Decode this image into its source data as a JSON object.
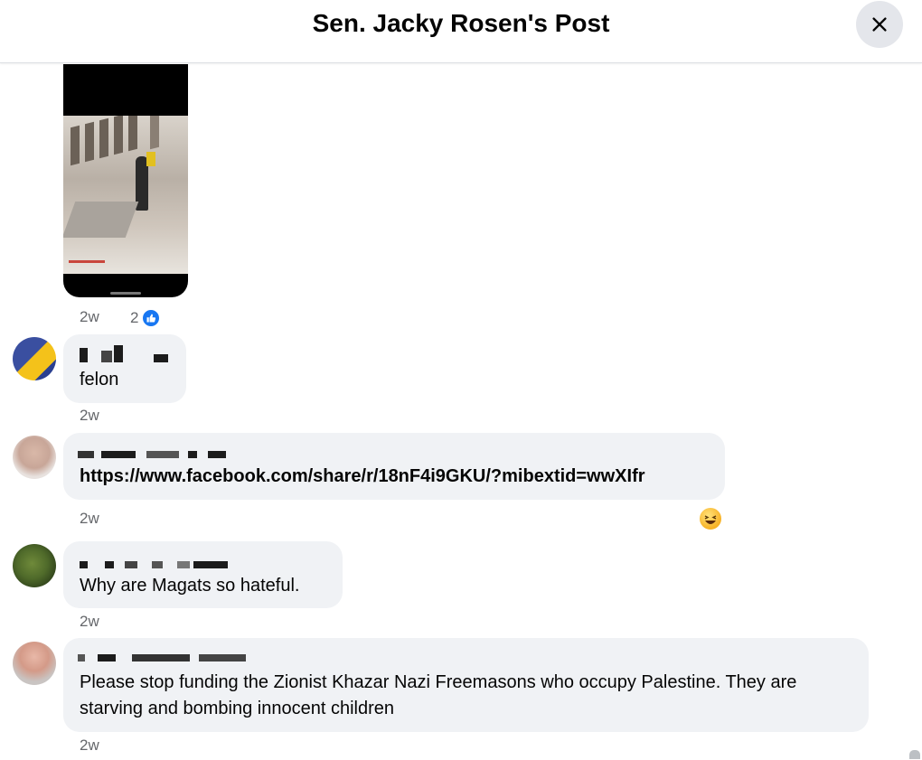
{
  "header": {
    "title": "Sen. Jacky Rosen's Post",
    "close_icon": "close-icon"
  },
  "post": {
    "time": "2w",
    "like_count": "2",
    "like_icon": "like-icon"
  },
  "comments": [
    {
      "text": "felon",
      "time": "2w"
    },
    {
      "text": "https://www.facebook.com/share/r/18nF4i9GKU/?mibextid=wwXIfr",
      "time": "2w",
      "reaction_icon": "haha-reaction-icon"
    },
    {
      "text": "Why are Magats so hateful.",
      "time": "2w"
    },
    {
      "text": "Please stop funding the Zionist Khazar Nazi Freemasons who occupy Palestine. They are starving and bombing innocent children",
      "time": "2w"
    }
  ],
  "colors": {
    "like_blue": "#1877f2",
    "bubble_bg": "#f0f2f5",
    "meta_gray": "#65676b"
  }
}
